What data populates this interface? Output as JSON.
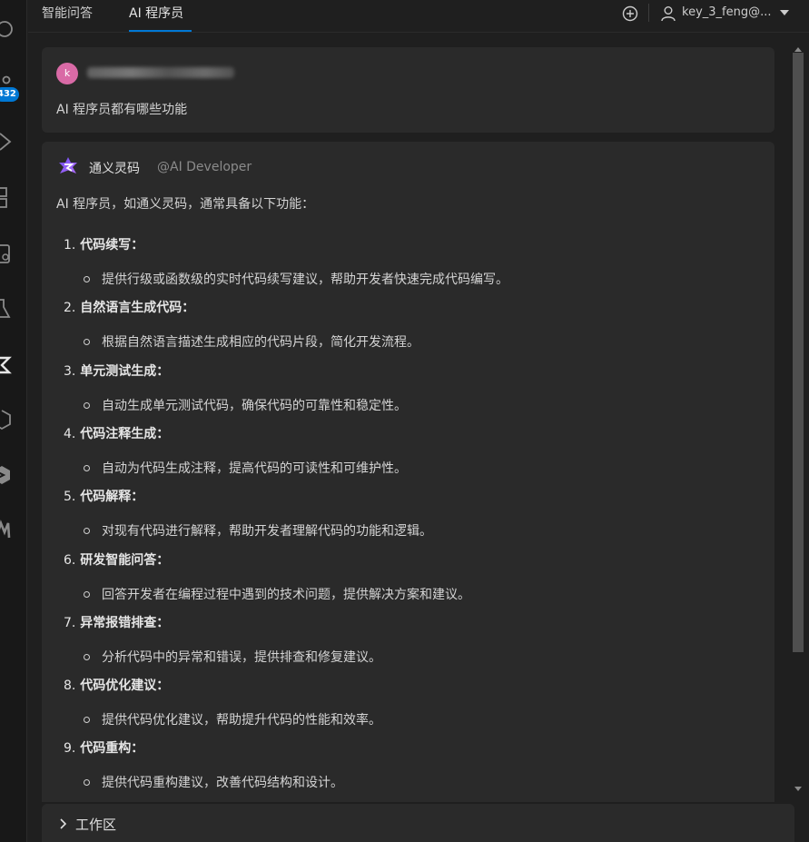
{
  "tabs": [
    {
      "label": "智能问答",
      "active": false
    },
    {
      "label": "AI 程序员",
      "active": true
    }
  ],
  "toolbar": {
    "new_icon": "plus-circle-icon",
    "user_label": "key_3_feng@...",
    "dropdown_icon": "caret-down-icon"
  },
  "activity_bar": {
    "badge": "432"
  },
  "question": {
    "avatar_letter": "k",
    "text": "AI 程序员都有哪些功能"
  },
  "answer": {
    "bot_name": "通义灵码",
    "bot_handle": "@AI Developer",
    "intro": "AI 程序员，如通义灵码，通常具备以下功能：",
    "items": [
      {
        "num": "1.",
        "title": "代码续写：",
        "desc": "提供行级或函数级的实时代码续写建议，帮助开发者快速完成代码编写。"
      },
      {
        "num": "2.",
        "title": "自然语言生成代码：",
        "desc": "根据自然语言描述生成相应的代码片段，简化开发流程。"
      },
      {
        "num": "3.",
        "title": "单元测试生成：",
        "desc": "自动生成单元测试代码，确保代码的可靠性和稳定性。"
      },
      {
        "num": "4.",
        "title": "代码注释生成：",
        "desc": "自动为代码生成注释，提高代码的可读性和可维护性。"
      },
      {
        "num": "5.",
        "title": "代码解释：",
        "desc": "对现有代码进行解释，帮助开发者理解代码的功能和逻辑。"
      },
      {
        "num": "6.",
        "title": "研发智能问答：",
        "desc": "回答开发者在编程过程中遇到的技术问题，提供解决方案和建议。"
      },
      {
        "num": "7.",
        "title": "异常报错排查：",
        "desc": "分析代码中的异常和错误，提供排查和修复建议。"
      },
      {
        "num": "8.",
        "title": "代码优化建议：",
        "desc": "提供代码优化建议，帮助提升代码的性能和效率。"
      },
      {
        "num": "9.",
        "title": "代码重构：",
        "desc": "提供代码重构建议，改善代码结构和设计。"
      }
    ]
  },
  "workspace": {
    "label": "工作区"
  },
  "colors": {
    "accent": "#0078d4",
    "background": "#1f1f1f",
    "card": "#2a2a2a"
  }
}
